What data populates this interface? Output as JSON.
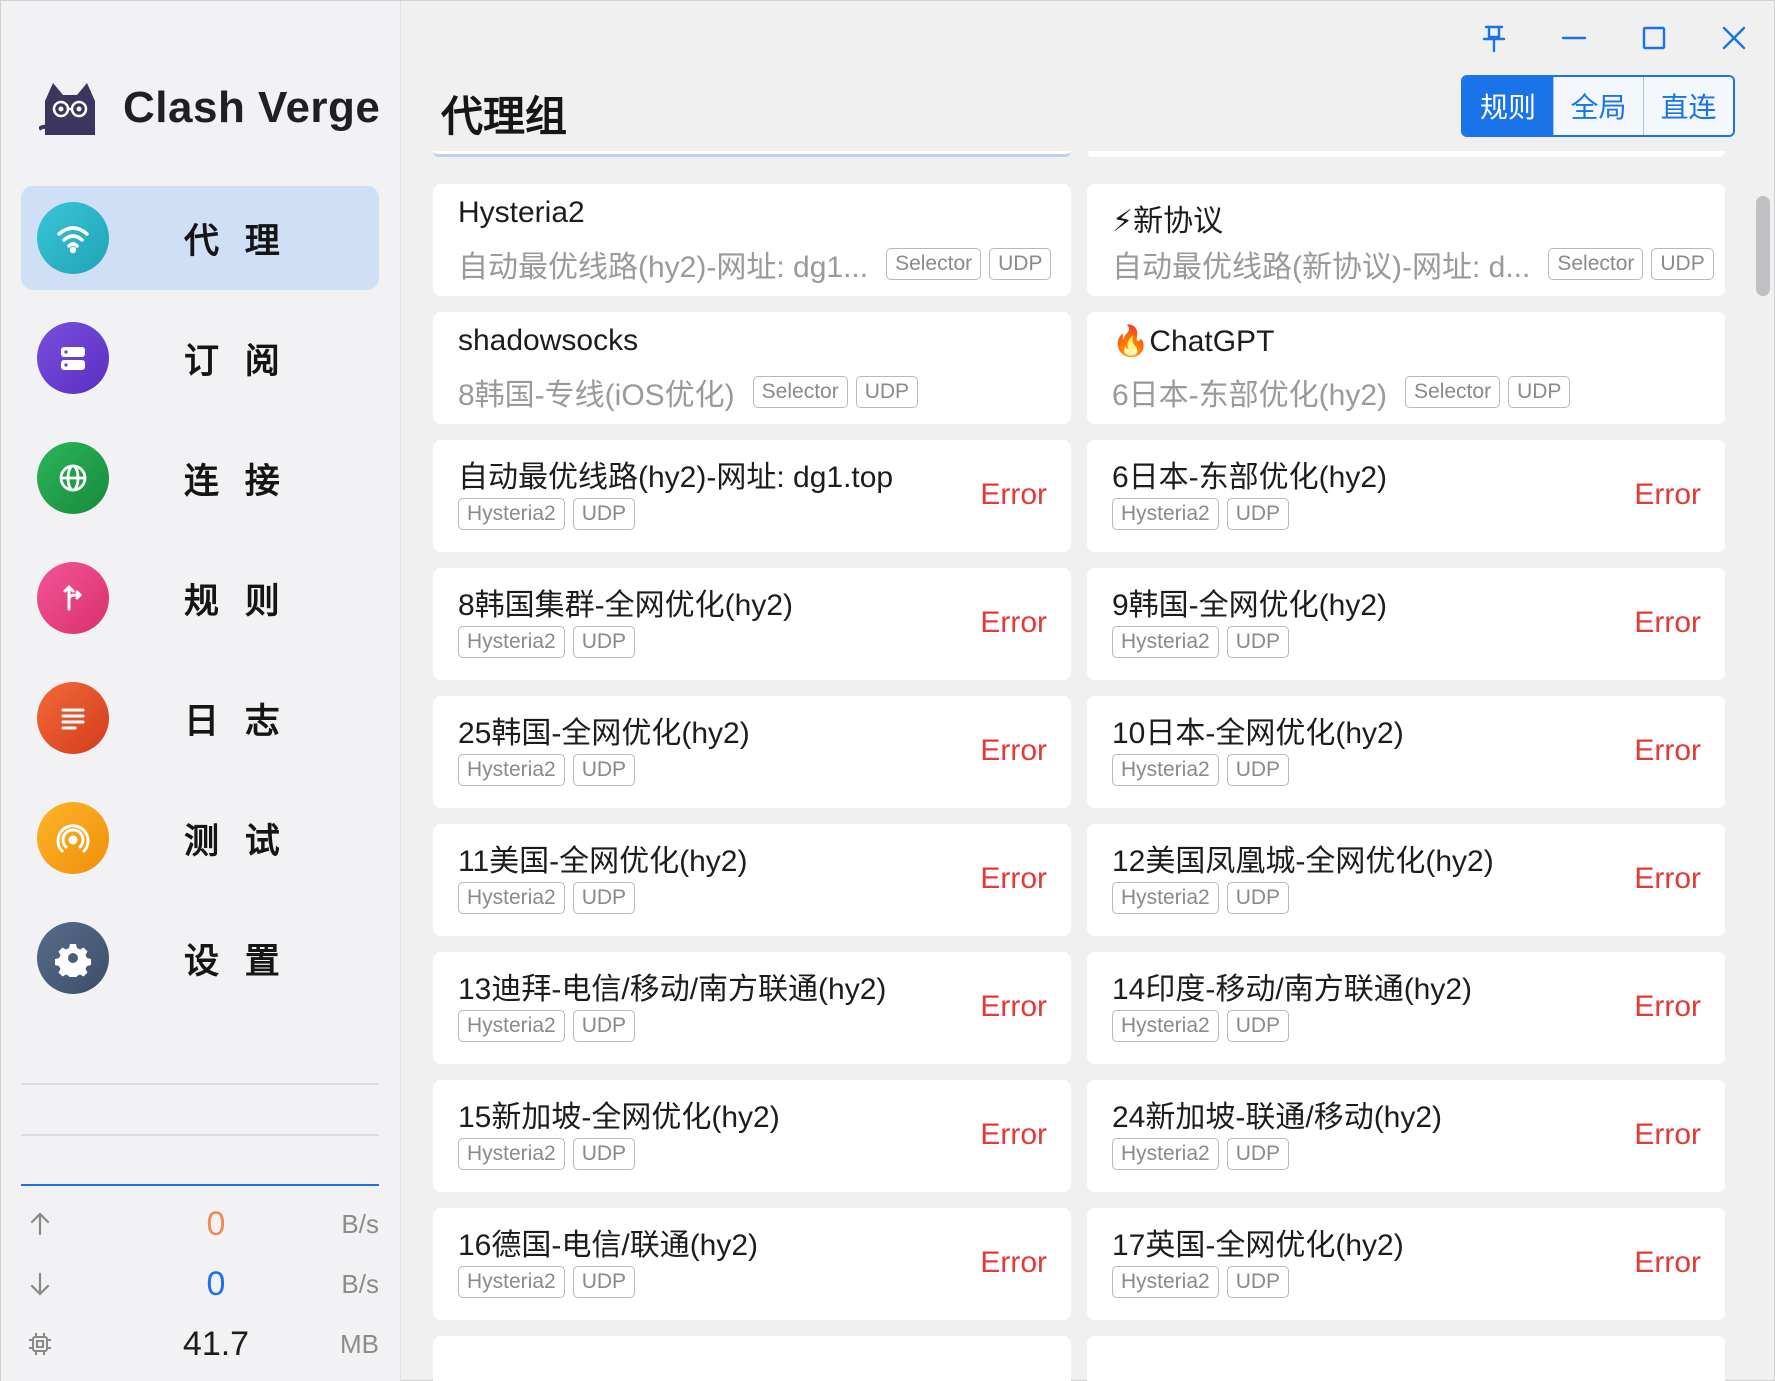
{
  "app": {
    "name": "Clash Verge"
  },
  "sidebar": {
    "items": [
      {
        "label": "代 理",
        "icon": "wifi-icon",
        "color": "#26b5c6",
        "active": true
      },
      {
        "label": "订 阅",
        "icon": "subscription-icon",
        "color": "#6a3fd0",
        "active": false
      },
      {
        "label": "连 接",
        "icon": "globe-icon",
        "color": "#1e9e4a",
        "active": false
      },
      {
        "label": "规 则",
        "icon": "rules-icon",
        "color": "#ec3f82",
        "active": false
      },
      {
        "label": "日 志",
        "icon": "logs-icon",
        "color": "#e8502a",
        "active": false
      },
      {
        "label": "测 试",
        "icon": "test-icon",
        "color": "#f6a213",
        "active": false
      },
      {
        "label": "设 置",
        "icon": "gear-icon",
        "color": "#4a5e7a",
        "active": false
      }
    ],
    "traffic": {
      "upload": {
        "value": "0",
        "unit": "B/s",
        "color": "#f08a5d"
      },
      "download": {
        "value": "0",
        "unit": "B/s",
        "color": "#1a73e8"
      },
      "memory": {
        "value": "41.7",
        "unit": "MB",
        "color": "#1c1c1c"
      }
    }
  },
  "header": {
    "title": "代理组",
    "modes": [
      {
        "label": "规则",
        "active": true
      },
      {
        "label": "全局",
        "active": false
      },
      {
        "label": "直连",
        "active": false
      }
    ]
  },
  "groups": [
    {
      "name": "Hysteria2",
      "now": "自动最优线路(hy2)-网址: dg1...",
      "tags": [
        "Selector",
        "UDP"
      ]
    },
    {
      "name": "⚡新协议",
      "now": "自动最优线路(新协议)-网址: d...",
      "tags": [
        "Selector",
        "UDP"
      ]
    },
    {
      "name": "shadowsocks",
      "now": "8韩国-专线(iOS优化)",
      "tags": [
        "Selector",
        "UDP"
      ]
    },
    {
      "name": "🔥ChatGPT",
      "now": "6日本-东部优化(hy2)",
      "tags": [
        "Selector",
        "UDP"
      ]
    }
  ],
  "proxies": [
    {
      "name": "自动最优线路(hy2)-网址: dg1.top",
      "tags": [
        "Hysteria2",
        "UDP"
      ],
      "delay": "Error"
    },
    {
      "name": "6日本-东部优化(hy2)",
      "tags": [
        "Hysteria2",
        "UDP"
      ],
      "delay": "Error"
    },
    {
      "name": "8韩国集群-全网优化(hy2)",
      "tags": [
        "Hysteria2",
        "UDP"
      ],
      "delay": "Error"
    },
    {
      "name": "9韩国-全网优化(hy2)",
      "tags": [
        "Hysteria2",
        "UDP"
      ],
      "delay": "Error"
    },
    {
      "name": "25韩国-全网优化(hy2)",
      "tags": [
        "Hysteria2",
        "UDP"
      ],
      "delay": "Error"
    },
    {
      "name": "10日本-全网优化(hy2)",
      "tags": [
        "Hysteria2",
        "UDP"
      ],
      "delay": "Error"
    },
    {
      "name": "11美国-全网优化(hy2)",
      "tags": [
        "Hysteria2",
        "UDP"
      ],
      "delay": "Error"
    },
    {
      "name": "12美国凤凰城-全网优化(hy2)",
      "tags": [
        "Hysteria2",
        "UDP"
      ],
      "delay": "Error"
    },
    {
      "name": "13迪拜-电信/移动/南方联通(hy2)",
      "tags": [
        "Hysteria2",
        "UDP"
      ],
      "delay": "Error"
    },
    {
      "name": "14印度-移动/南方联通(hy2)",
      "tags": [
        "Hysteria2",
        "UDP"
      ],
      "delay": "Error"
    },
    {
      "name": "15新加坡-全网优化(hy2)",
      "tags": [
        "Hysteria2",
        "UDP"
      ],
      "delay": "Error"
    },
    {
      "name": "24新加坡-联通/移动(hy2)",
      "tags": [
        "Hysteria2",
        "UDP"
      ],
      "delay": "Error"
    },
    {
      "name": "16德国-电信/联通(hy2)",
      "tags": [
        "Hysteria2",
        "UDP"
      ],
      "delay": "Error"
    },
    {
      "name": "17英国-全网优化(hy2)",
      "tags": [
        "Hysteria2",
        "UDP"
      ],
      "delay": "Error"
    }
  ]
}
